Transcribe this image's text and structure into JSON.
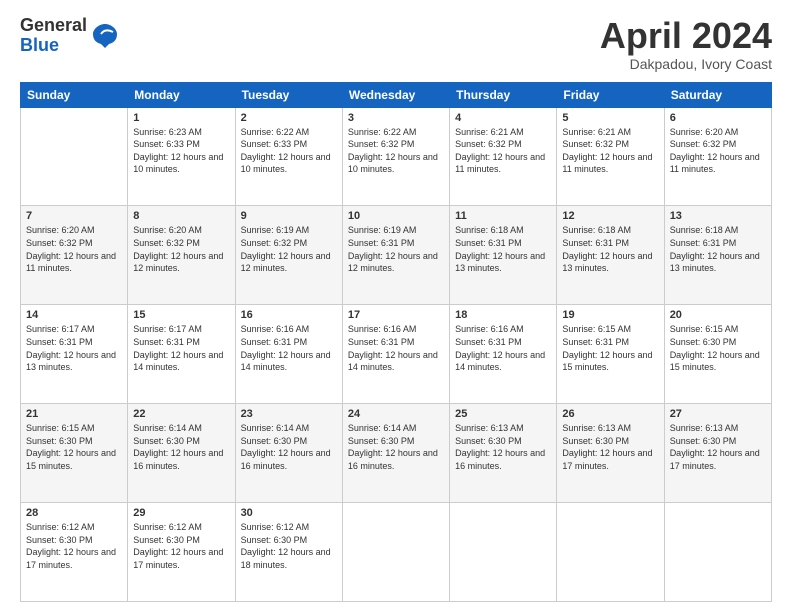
{
  "logo": {
    "general": "General",
    "blue": "Blue"
  },
  "header": {
    "month": "April 2024",
    "location": "Dakpadou, Ivory Coast"
  },
  "weekdays": [
    "Sunday",
    "Monday",
    "Tuesday",
    "Wednesday",
    "Thursday",
    "Friday",
    "Saturday"
  ],
  "weeks": [
    [
      {
        "day": "",
        "sunrise": "",
        "sunset": "",
        "daylight": ""
      },
      {
        "day": "1",
        "sunrise": "Sunrise: 6:23 AM",
        "sunset": "Sunset: 6:33 PM",
        "daylight": "Daylight: 12 hours and 10 minutes."
      },
      {
        "day": "2",
        "sunrise": "Sunrise: 6:22 AM",
        "sunset": "Sunset: 6:33 PM",
        "daylight": "Daylight: 12 hours and 10 minutes."
      },
      {
        "day": "3",
        "sunrise": "Sunrise: 6:22 AM",
        "sunset": "Sunset: 6:32 PM",
        "daylight": "Daylight: 12 hours and 10 minutes."
      },
      {
        "day": "4",
        "sunrise": "Sunrise: 6:21 AM",
        "sunset": "Sunset: 6:32 PM",
        "daylight": "Daylight: 12 hours and 11 minutes."
      },
      {
        "day": "5",
        "sunrise": "Sunrise: 6:21 AM",
        "sunset": "Sunset: 6:32 PM",
        "daylight": "Daylight: 12 hours and 11 minutes."
      },
      {
        "day": "6",
        "sunrise": "Sunrise: 6:20 AM",
        "sunset": "Sunset: 6:32 PM",
        "daylight": "Daylight: 12 hours and 11 minutes."
      }
    ],
    [
      {
        "day": "7",
        "sunrise": "Sunrise: 6:20 AM",
        "sunset": "Sunset: 6:32 PM",
        "daylight": "Daylight: 12 hours and 11 minutes."
      },
      {
        "day": "8",
        "sunrise": "Sunrise: 6:20 AM",
        "sunset": "Sunset: 6:32 PM",
        "daylight": "Daylight: 12 hours and 12 minutes."
      },
      {
        "day": "9",
        "sunrise": "Sunrise: 6:19 AM",
        "sunset": "Sunset: 6:32 PM",
        "daylight": "Daylight: 12 hours and 12 minutes."
      },
      {
        "day": "10",
        "sunrise": "Sunrise: 6:19 AM",
        "sunset": "Sunset: 6:31 PM",
        "daylight": "Daylight: 12 hours and 12 minutes."
      },
      {
        "day": "11",
        "sunrise": "Sunrise: 6:18 AM",
        "sunset": "Sunset: 6:31 PM",
        "daylight": "Daylight: 12 hours and 13 minutes."
      },
      {
        "day": "12",
        "sunrise": "Sunrise: 6:18 AM",
        "sunset": "Sunset: 6:31 PM",
        "daylight": "Daylight: 12 hours and 13 minutes."
      },
      {
        "day": "13",
        "sunrise": "Sunrise: 6:18 AM",
        "sunset": "Sunset: 6:31 PM",
        "daylight": "Daylight: 12 hours and 13 minutes."
      }
    ],
    [
      {
        "day": "14",
        "sunrise": "Sunrise: 6:17 AM",
        "sunset": "Sunset: 6:31 PM",
        "daylight": "Daylight: 12 hours and 13 minutes."
      },
      {
        "day": "15",
        "sunrise": "Sunrise: 6:17 AM",
        "sunset": "Sunset: 6:31 PM",
        "daylight": "Daylight: 12 hours and 14 minutes."
      },
      {
        "day": "16",
        "sunrise": "Sunrise: 6:16 AM",
        "sunset": "Sunset: 6:31 PM",
        "daylight": "Daylight: 12 hours and 14 minutes."
      },
      {
        "day": "17",
        "sunrise": "Sunrise: 6:16 AM",
        "sunset": "Sunset: 6:31 PM",
        "daylight": "Daylight: 12 hours and 14 minutes."
      },
      {
        "day": "18",
        "sunrise": "Sunrise: 6:16 AM",
        "sunset": "Sunset: 6:31 PM",
        "daylight": "Daylight: 12 hours and 14 minutes."
      },
      {
        "day": "19",
        "sunrise": "Sunrise: 6:15 AM",
        "sunset": "Sunset: 6:31 PM",
        "daylight": "Daylight: 12 hours and 15 minutes."
      },
      {
        "day": "20",
        "sunrise": "Sunrise: 6:15 AM",
        "sunset": "Sunset: 6:30 PM",
        "daylight": "Daylight: 12 hours and 15 minutes."
      }
    ],
    [
      {
        "day": "21",
        "sunrise": "Sunrise: 6:15 AM",
        "sunset": "Sunset: 6:30 PM",
        "daylight": "Daylight: 12 hours and 15 minutes."
      },
      {
        "day": "22",
        "sunrise": "Sunrise: 6:14 AM",
        "sunset": "Sunset: 6:30 PM",
        "daylight": "Daylight: 12 hours and 16 minutes."
      },
      {
        "day": "23",
        "sunrise": "Sunrise: 6:14 AM",
        "sunset": "Sunset: 6:30 PM",
        "daylight": "Daylight: 12 hours and 16 minutes."
      },
      {
        "day": "24",
        "sunrise": "Sunrise: 6:14 AM",
        "sunset": "Sunset: 6:30 PM",
        "daylight": "Daylight: 12 hours and 16 minutes."
      },
      {
        "day": "25",
        "sunrise": "Sunrise: 6:13 AM",
        "sunset": "Sunset: 6:30 PM",
        "daylight": "Daylight: 12 hours and 16 minutes."
      },
      {
        "day": "26",
        "sunrise": "Sunrise: 6:13 AM",
        "sunset": "Sunset: 6:30 PM",
        "daylight": "Daylight: 12 hours and 17 minutes."
      },
      {
        "day": "27",
        "sunrise": "Sunrise: 6:13 AM",
        "sunset": "Sunset: 6:30 PM",
        "daylight": "Daylight: 12 hours and 17 minutes."
      }
    ],
    [
      {
        "day": "28",
        "sunrise": "Sunrise: 6:12 AM",
        "sunset": "Sunset: 6:30 PM",
        "daylight": "Daylight: 12 hours and 17 minutes."
      },
      {
        "day": "29",
        "sunrise": "Sunrise: 6:12 AM",
        "sunset": "Sunset: 6:30 PM",
        "daylight": "Daylight: 12 hours and 17 minutes."
      },
      {
        "day": "30",
        "sunrise": "Sunrise: 6:12 AM",
        "sunset": "Sunset: 6:30 PM",
        "daylight": "Daylight: 12 hours and 18 minutes."
      },
      {
        "day": "",
        "sunrise": "",
        "sunset": "",
        "daylight": ""
      },
      {
        "day": "",
        "sunrise": "",
        "sunset": "",
        "daylight": ""
      },
      {
        "day": "",
        "sunrise": "",
        "sunset": "",
        "daylight": ""
      },
      {
        "day": "",
        "sunrise": "",
        "sunset": "",
        "daylight": ""
      }
    ]
  ]
}
